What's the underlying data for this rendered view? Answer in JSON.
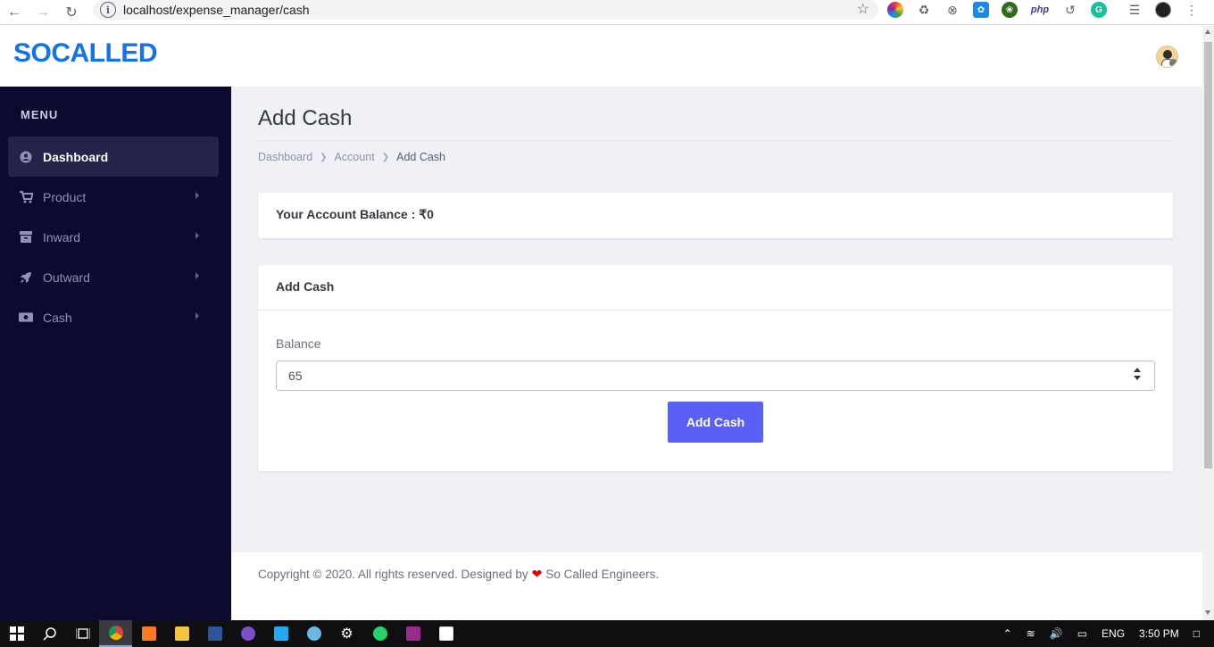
{
  "browser": {
    "url": "localhost/expense_manager/cash",
    "extensions": [
      "color-wheel-icon",
      "recycle-icon",
      "close-circle-icon",
      "messenger-icon",
      "leaf-icon",
      "php-icon",
      "history-icon",
      "grammarly-icon",
      "playlist-icon",
      "profile-icon",
      "more-icon"
    ],
    "php_label": "php"
  },
  "header": {
    "logo": "SOCALLED",
    "avatar_icon": "user-avatar-icon"
  },
  "sidebar": {
    "menu_title": "MENU",
    "items": [
      {
        "label": "Dashboard",
        "icon": "dashboard-icon",
        "active": true
      },
      {
        "label": "Product",
        "icon": "cart-icon",
        "has_submenu": true
      },
      {
        "label": "Inward",
        "icon": "archive-icon",
        "has_submenu": true
      },
      {
        "label": "Outward",
        "icon": "rocket-icon",
        "has_submenu": true
      },
      {
        "label": "Cash",
        "icon": "money-icon",
        "has_submenu": true
      }
    ]
  },
  "main": {
    "page_title": "Add Cash",
    "breadcrumb": [
      "Dashboard",
      "Account",
      "Add Cash"
    ],
    "balance_text": "Your Account Balance : ₹0",
    "form": {
      "title": "Add Cash",
      "field_label": "Balance",
      "field_value": "65",
      "submit_label": "Add Cash"
    }
  },
  "footer": {
    "text_before": "Copyright © 2020. All rights reserved. Designed by",
    "text_after": "So Called Engineers."
  },
  "taskbar": {
    "language": "ENG",
    "time": "3:50 PM"
  },
  "colors": {
    "brand": "#1273eb",
    "sidebar_bg": "#0d0a30",
    "primary_button": "#5a60f4",
    "heart": "#e60000"
  }
}
